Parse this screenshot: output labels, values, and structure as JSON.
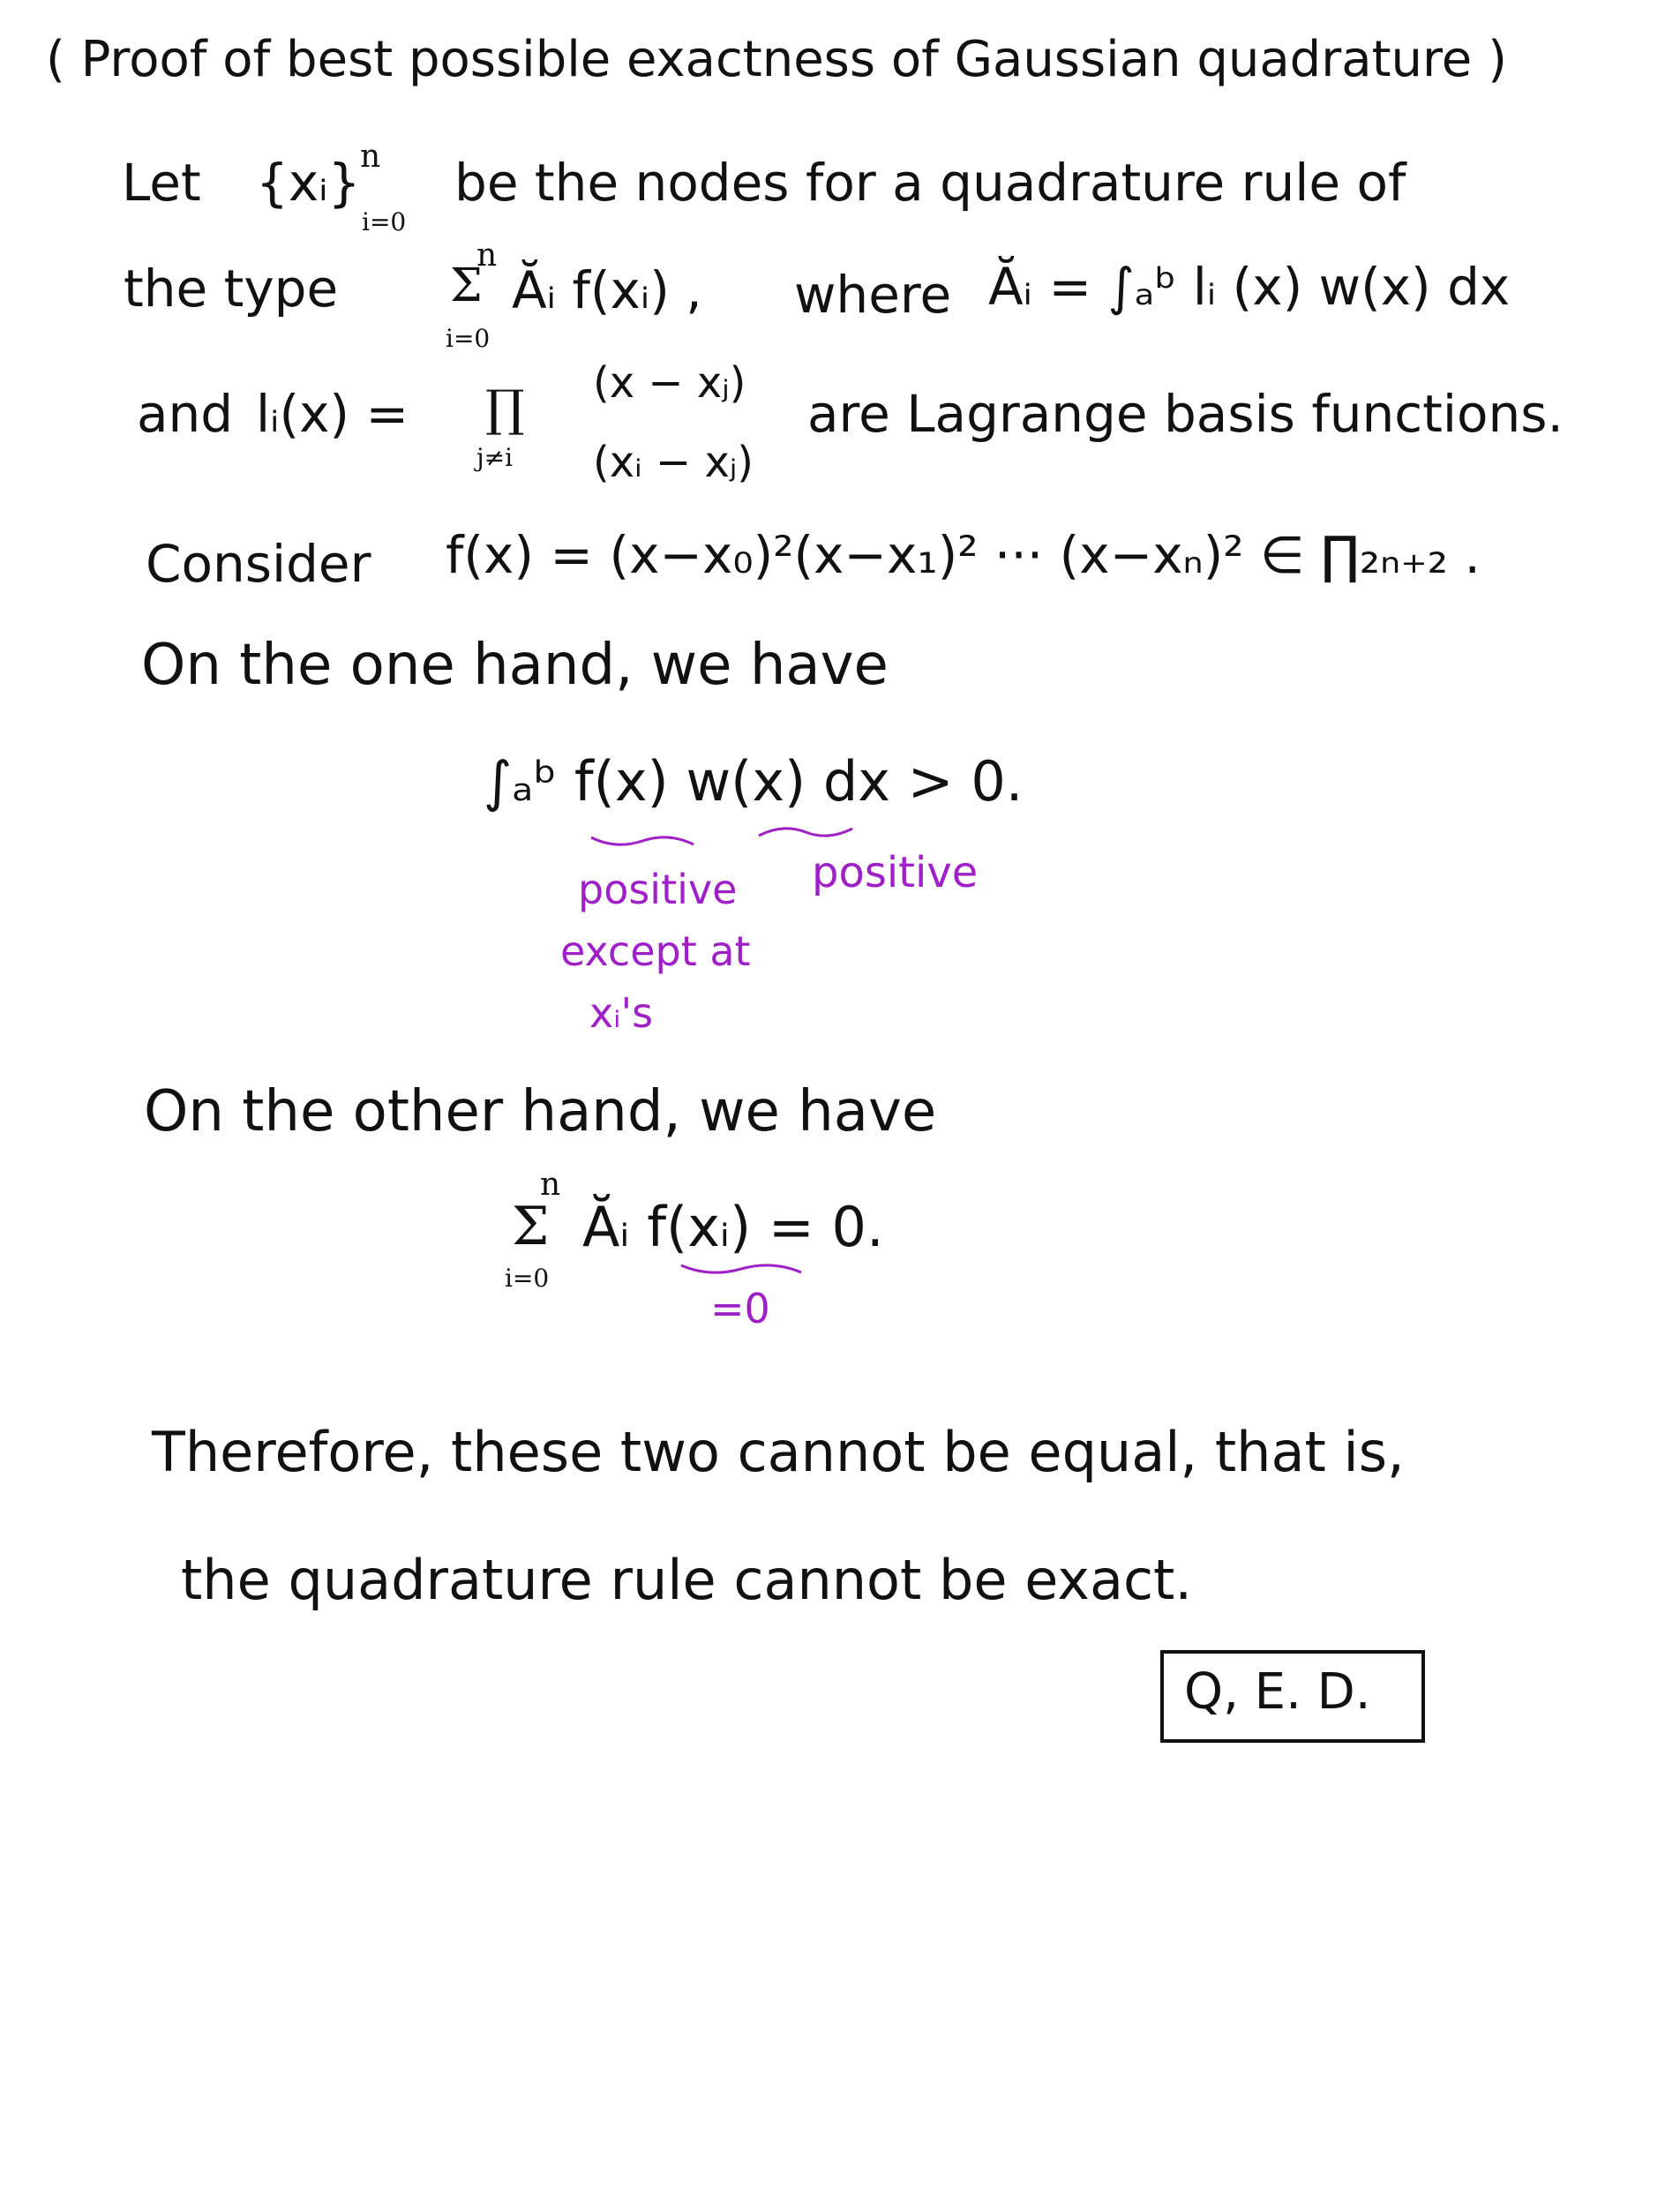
{
  "title": "( Proof of best possible exactness of Gaussian quadrature )",
  "line1": {
    "let": "Let",
    "set": "{xᵢ}",
    "sup_n": "n",
    "sub_i0": "i=0",
    "rest": "be the nodes for a quadrature rule of"
  },
  "line2": {
    "the_type": "the type",
    "sum_top": "n",
    "sum_sym": "Σ",
    "sum_bottom": "i=0",
    "term": "Ăᵢ f(xᵢ) ,",
    "where": "where",
    "def": "Ăᵢ = ∫ₐᵇ lᵢ (x) w(x) dx"
  },
  "line3": {
    "and": "and",
    "li": "lᵢ(x) =",
    "prod_sym": "∏",
    "prod_bottom": "j≠i",
    "numerator": "(x − xⱼ)",
    "denominator": "(xᵢ − xⱼ)",
    "rest": "are Lagrange basis functions."
  },
  "line4": {
    "consider": "Consider",
    "expr": "f(x) = (x−x₀)²(x−x₁)² ··· (x−xₙ)² ∈ ∏₂ₙ₊₂ ."
  },
  "line5": "On the one hand,  we have",
  "integral": {
    "expr": "∫ₐᵇ f(x)  w(x)  dx  > 0.",
    "note_f": "positive",
    "note_f2": "except at",
    "note_f3": "xᵢ's",
    "note_w": "positive"
  },
  "line6": "On the other hand,   we have",
  "sum_eq": {
    "top": "n",
    "sym": "Σ",
    "bottom": "i=0",
    "expr": "Ăᵢ f(xᵢ) = 0.",
    "note": "=0"
  },
  "line7": "Therefore,  these two  cannot  be equal,  that is,",
  "line8": "the quadrature  rule  cannot  be  exact.",
  "qed": "Q, E. D.",
  "colors": {
    "ink": "#111111",
    "annotation": "#a020c8"
  }
}
